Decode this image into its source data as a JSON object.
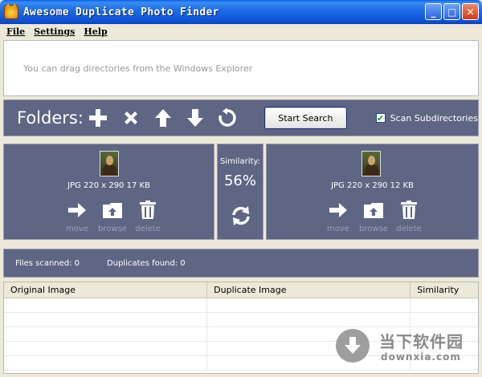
{
  "window": {
    "title": "Awesome Duplicate Photo Finder",
    "minimize": "_",
    "maximize": "□",
    "close": "✕"
  },
  "menu": [
    {
      "key": "F",
      "rest": "ile"
    },
    {
      "key": "S",
      "rest": "ettings"
    },
    {
      "key": "H",
      "rest": "elp"
    }
  ],
  "drop_area": {
    "hint": "You can drag directories from the Windows Explorer"
  },
  "folders_bar": {
    "label": "Folders:",
    "icons": [
      "add-icon",
      "remove-icon",
      "move-up-icon",
      "move-down-icon",
      "reset-icon"
    ],
    "start_button": "Start Search",
    "scan_subdirectories_label": "Scan Subdirectories",
    "scan_subdirectories_checked": true
  },
  "left_image": {
    "info": "JPG  220 x 290  17 KB",
    "actions": [
      "move",
      "browse",
      "delete"
    ]
  },
  "similarity": {
    "label": "Similarity:",
    "value": "56%"
  },
  "right_image": {
    "info": "JPG  220 x 290  12 KB",
    "actions": [
      "move",
      "browse",
      "delete"
    ]
  },
  "status": {
    "files_scanned": "Files scanned: 0",
    "duplicates_found": "Duplicates found: 0"
  },
  "table": {
    "columns": [
      "Original Image",
      "Duplicate Image",
      "Similarity"
    ]
  },
  "watermark": {
    "cn": "当下软件园",
    "en": "downxia.com"
  },
  "colors": {
    "panel": "#5f6684",
    "titlebar": "#0b4fd3",
    "background": "#ece9d8"
  }
}
